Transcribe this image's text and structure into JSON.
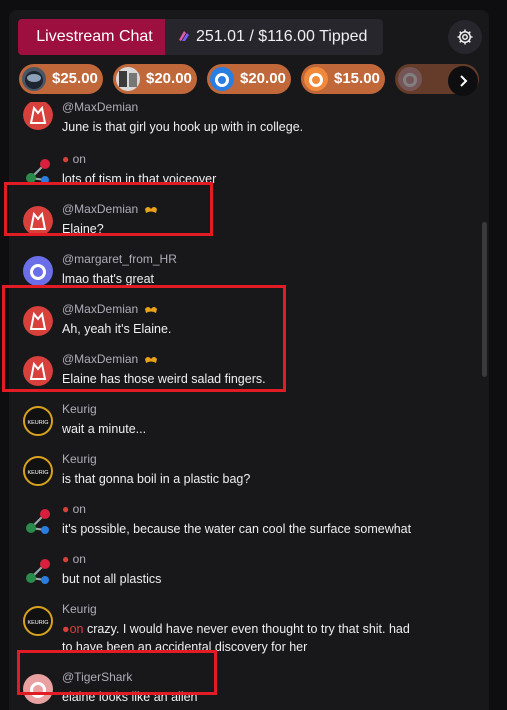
{
  "header": {
    "tab_label": "Livestream Chat",
    "tips_summary": "251.01 / $116.00 Tipped"
  },
  "tip_pills": [
    {
      "amount": "$25.00"
    },
    {
      "amount": "$20.00"
    },
    {
      "amount": "$20.00"
    },
    {
      "amount": "$15.00"
    },
    {
      "amount": ""
    }
  ],
  "messages": [
    {
      "name": "@MaxDemian",
      "text": "June is that girl you hook up with in college."
    },
    {
      "name": "on",
      "text": "lots of tism in that voiceover"
    },
    {
      "name": "@MaxDemian",
      "text": "Elaine?"
    },
    {
      "name": "@margaret_from_HR",
      "text": "lmao that's great"
    },
    {
      "name": "@MaxDemian",
      "text": "Ah, yeah it's Elaine."
    },
    {
      "name": "@MaxDemian",
      "text": "Elaine has those weird salad fingers."
    },
    {
      "name": "Keurig",
      "text": "wait a minute..."
    },
    {
      "name": "Keurig",
      "text": "is that gonna boil in a plastic bag?"
    },
    {
      "name": "on",
      "text": "it's possible, because the water can cool the surface somewhat"
    },
    {
      "name": "on",
      "text": "but not all plastics"
    },
    {
      "name": "Keurig",
      "text_prefix": "on",
      "text": "crazy. I would have never even thought to try that shit. had",
      "text2": "to have been an accidental discovery for her"
    },
    {
      "name": "@TigerShark",
      "text": "elaine looks like an alien"
    }
  ],
  "avatar_label": "KEURIG",
  "colors": {
    "accent": "#9c0f3f",
    "tip_pill": "#c0683a",
    "highlight": "#e21c24",
    "panel": "#18181b"
  },
  "icons": {
    "settings": "gear-icon",
    "next": "chevron-right-icon",
    "badge": "mustache-badge-icon"
  }
}
